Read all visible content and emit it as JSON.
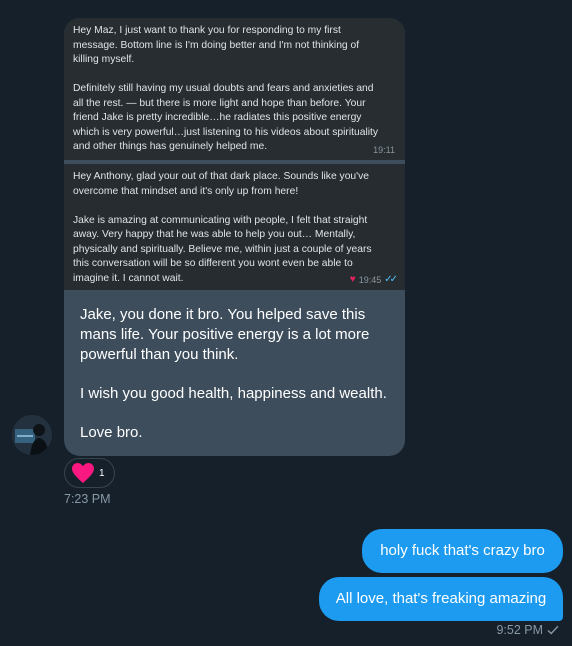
{
  "conversation": {
    "incoming": {
      "screenshot_1": {
        "paragraph_1": "Hey Maz, I just want to thank you for responding to my first\nmessage.  Bottom line is I'm doing better and I'm not thinking of\nkilling myself.",
        "paragraph_2": "Definitely still having my usual doubts and fears and anxieties and\nall the rest. — but there is more light and hope than before.  Your\nfriend Jake is pretty incredible…he radiates this positive energy\nwhich is very powerful…just listening to his videos about spirituality\nand other things has genuinely helped me.",
        "time": "19:11"
      },
      "screenshot_2": {
        "paragraph_1": "Hey Anthony, glad your out of that dark place. Sounds like you've\novercome that mindset and it's only up from here!",
        "paragraph_2": "Jake is amazing at communicating with people, I felt that straight\naway. Very happy that he was able to help you out… Mentally,\nphysically and spiritually. Believe me, within just a couple of years\nthis conversation will be so different you wont even be able to\nimagine it. I cannot wait.",
        "time": "19:45"
      },
      "caption": {
        "line_1": "Jake, you done it bro. You helped save this mans life. Your positive energy is a lot more powerful than you think.",
        "line_2": "I wish you good health, happiness and wealth.",
        "line_3": "Love bro."
      },
      "reaction": {
        "icon": "heart-icon",
        "count": "1",
        "color": "#f91880"
      },
      "time": "7:23 PM"
    },
    "outgoing": {
      "messages": [
        "holy fuck that's crazy bro",
        "All love, that's freaking amazing"
      ],
      "time": "9:52 PM",
      "status_icon": "check-icon",
      "accent": "#1d9bf0"
    },
    "background": "#15202b"
  }
}
